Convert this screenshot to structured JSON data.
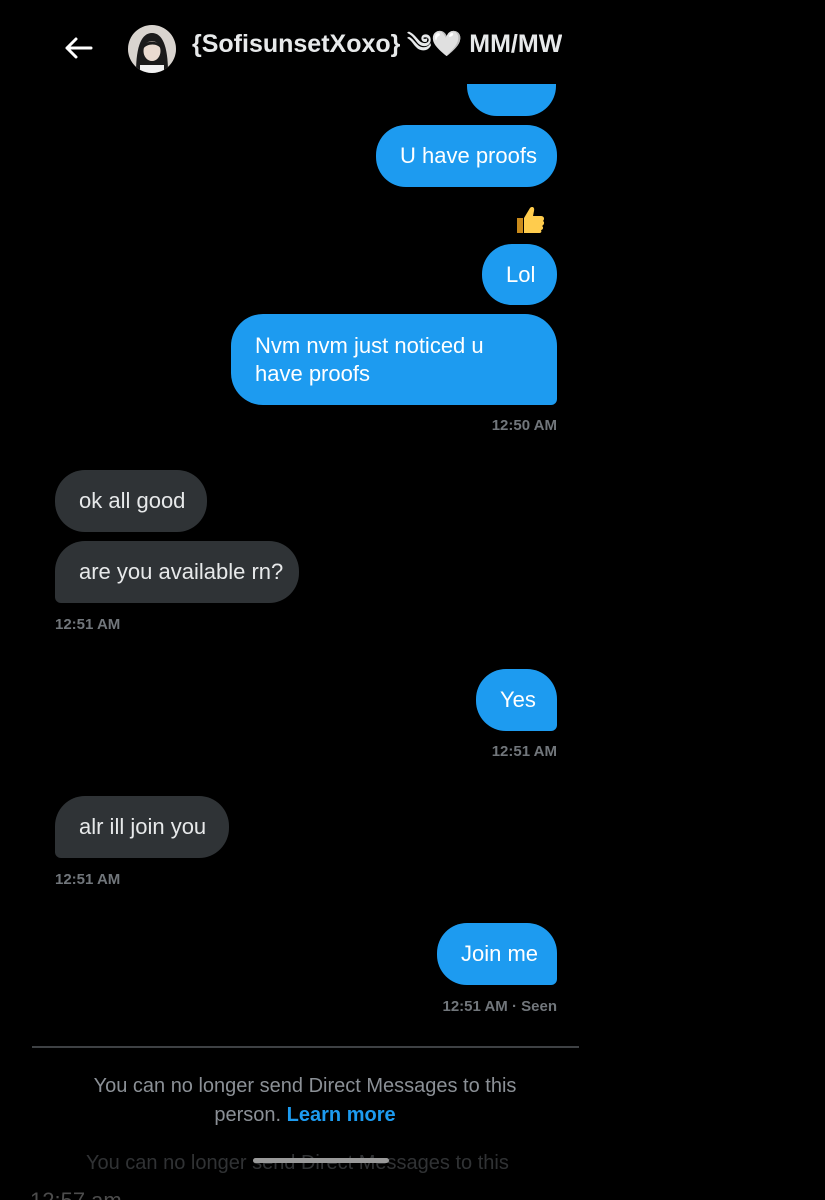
{
  "header": {
    "title": "{SofisunsetXoxo} ༄🤍 MM/MW ..."
  },
  "messages": [
    {
      "id": "m0",
      "side": "sent",
      "text": ""
    },
    {
      "id": "m1",
      "side": "sent",
      "text": "U have proofs",
      "reaction": "👍"
    },
    {
      "id": "m2",
      "side": "sent",
      "text": "Lol"
    },
    {
      "id": "m3",
      "side": "sent",
      "text": "Nvm nvm just noticed u have proofs",
      "time": "12:50 AM"
    },
    {
      "id": "m4",
      "side": "received",
      "text": "ok all good"
    },
    {
      "id": "m5",
      "side": "received",
      "text": "are you available rn?",
      "time": "12:51 AM"
    },
    {
      "id": "m6",
      "side": "sent",
      "text": "Yes",
      "time": "12:51 AM"
    },
    {
      "id": "m7",
      "side": "received",
      "text": "alr ill join you",
      "time": "12:51 AM"
    },
    {
      "id": "m8",
      "side": "sent",
      "text": "Join me",
      "time": "12:51 AM · Seen"
    }
  ],
  "notice": {
    "text": "You can no longer send Direct Messages to this person.",
    "link": "Learn more"
  },
  "overlay": {
    "faded_text": "You can no longer send Direct Messages to this",
    "faded_time": "12:57 am"
  },
  "colors": {
    "sent_bubble": "#1d9bf0",
    "received_bubble": "#2f3336",
    "background": "#000000",
    "timestamp": "#71767b",
    "link": "#1d9bf0"
  }
}
